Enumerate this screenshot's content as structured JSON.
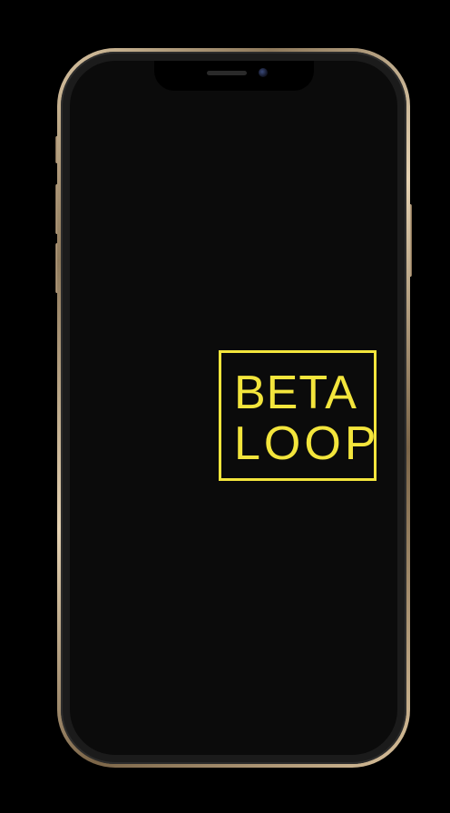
{
  "app": {
    "logo": {
      "line1": "BETA",
      "line2": "LOOP",
      "color": "#f3e53c"
    },
    "screen_background": "#0b0b0b",
    "device_frame_color": "#c9b190"
  }
}
